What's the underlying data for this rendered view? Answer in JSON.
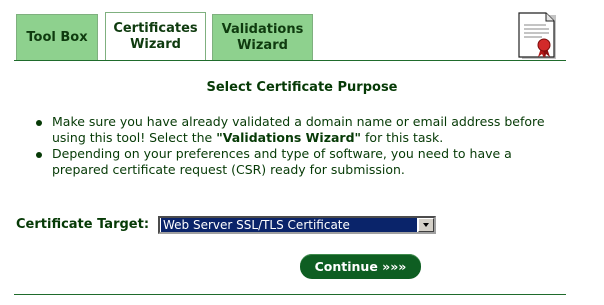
{
  "tabs": {
    "toolbox": "Tool Box",
    "certificates": [
      "Certificates",
      "Wizard"
    ],
    "validations": [
      "Validations",
      "Wizard"
    ]
  },
  "heading": "Select Certificate Purpose",
  "bullets": {
    "item1": {
      "before": "Make sure you have already validated a domain name or email address before using this tool! Select the ",
      "emphasis": "\"Validations Wizard\"",
      "after": " for this task."
    },
    "item2": "Depending on your preferences and type of software, you need to have a prepared certificate request (CSR) ready for submission."
  },
  "form": {
    "target_label": "Certificate Target:",
    "target_value": "Web Server SSL/TLS Certificate"
  },
  "continue_label": "Continue »»»",
  "colors": {
    "tab_inactive": "#8ed18e",
    "text": "#063a06",
    "button": "#0e5e22",
    "select_highlight": "#0a246a"
  },
  "icons": {
    "certificate": "certificate-document-icon",
    "dropdown": "chevron-down-icon"
  }
}
